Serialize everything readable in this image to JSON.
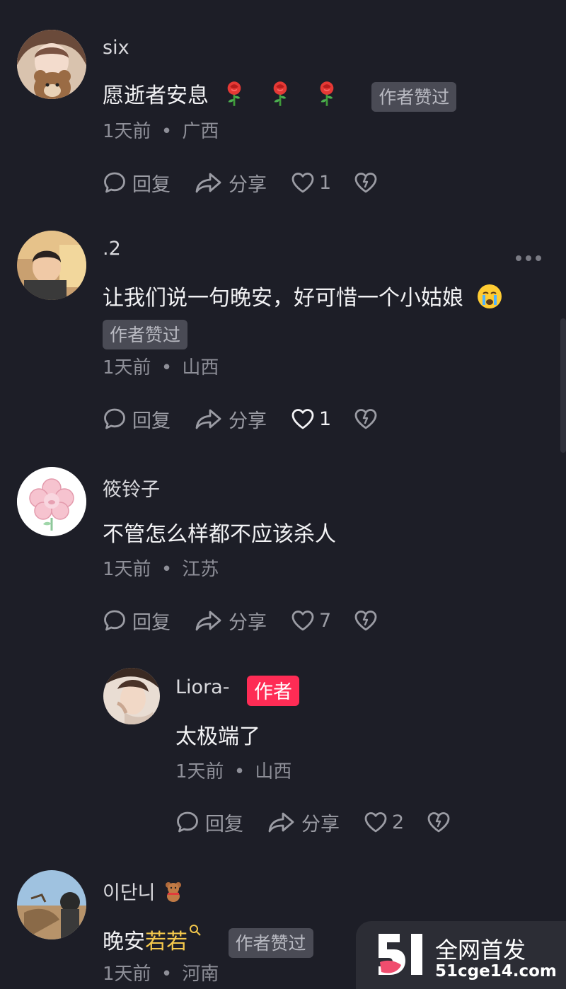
{
  "comments": [
    {
      "username": "six",
      "text": "愿逝者安息",
      "emojis": [
        "rose-emoji",
        "rose-emoji",
        "rose-emoji"
      ],
      "badge": "作者赞过",
      "time": "1天前",
      "location": "广西",
      "reply": "回复",
      "share": "分享",
      "likes": "1"
    },
    {
      "username": ".2",
      "text": "让我们说一句晚安，好可惜一个小姑娘",
      "emojis": [
        "crying-face-emoji"
      ],
      "badge": "作者赞过",
      "time": "1天前",
      "location": "山西",
      "reply": "回复",
      "share": "分享",
      "likes": "1"
    },
    {
      "username": "筱铃子",
      "text": "不管怎么样都不应该杀人",
      "time": "1天前",
      "location": "江苏",
      "reply": "回复",
      "share": "分享",
      "likes": "7",
      "replies": [
        {
          "username": "Liora-",
          "author_badge": "作者",
          "text": "太极端了",
          "time": "1天前",
          "location": "山西",
          "reply": "回复",
          "share": "分享",
          "likes": "2"
        }
      ]
    },
    {
      "username": "이단니",
      "username_emoji": "teddy-bear-emoji",
      "text": "晚安",
      "text_highlight": "若若",
      "badge": "作者赞过",
      "time": "1天前",
      "location": "河南"
    }
  ],
  "separator": "•",
  "watermark": {
    "title": "全网首发",
    "url": "51cge14.com"
  },
  "colors": {
    "background": "#1d1e27",
    "author_badge": "#fe2c55",
    "highlight": "#f5c94c"
  }
}
